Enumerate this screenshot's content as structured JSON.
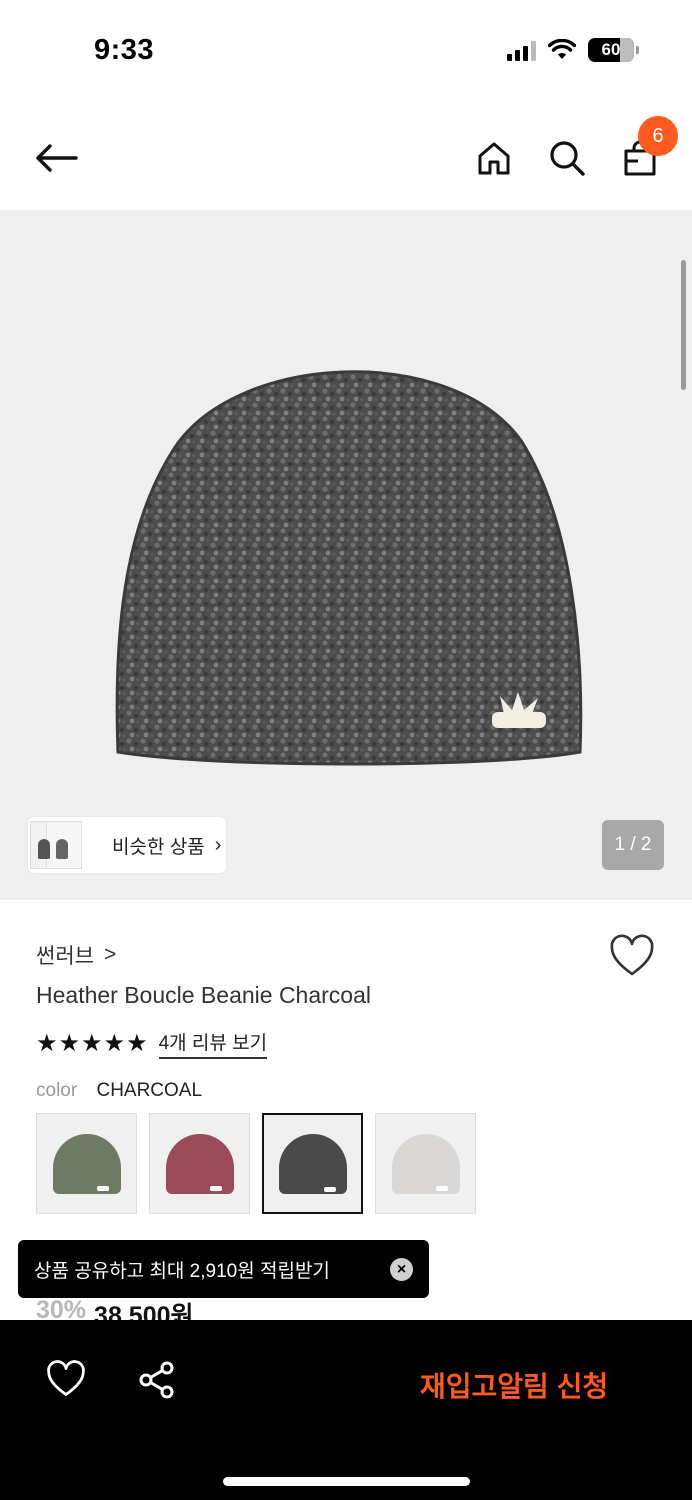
{
  "status": {
    "time": "9:33",
    "battery": "60"
  },
  "nav": {
    "cart_count": "6"
  },
  "hero": {
    "similar_label": "비슷한 상품",
    "pager": "1 / 2"
  },
  "product": {
    "brand": "썬러브",
    "brand_arrow": ">",
    "name": "Heather Boucle Beanie Charcoal",
    "stars": "★★★★★",
    "review_link": "4개 리뷰 보기",
    "color_key": "color",
    "color_value": "CHARCOAL",
    "swatches": [
      {
        "name": "olive",
        "color": "#6f7a62"
      },
      {
        "name": "berry",
        "color": "#9c4b5a"
      },
      {
        "name": "charcoal",
        "color": "#4a4a4a"
      },
      {
        "name": "light-grey",
        "color": "#d9d7d5"
      }
    ],
    "selected_swatch": "charcoal",
    "discount": "30%",
    "price": "38,500원"
  },
  "toast": {
    "text": "상품 공유하고 최대 2,910원 적립받기",
    "close": "×"
  },
  "bottom": {
    "restock_label": "재입고알림 신청"
  },
  "colors": {
    "accent": "#ff5a1f",
    "hero_bg": "#efefef"
  }
}
